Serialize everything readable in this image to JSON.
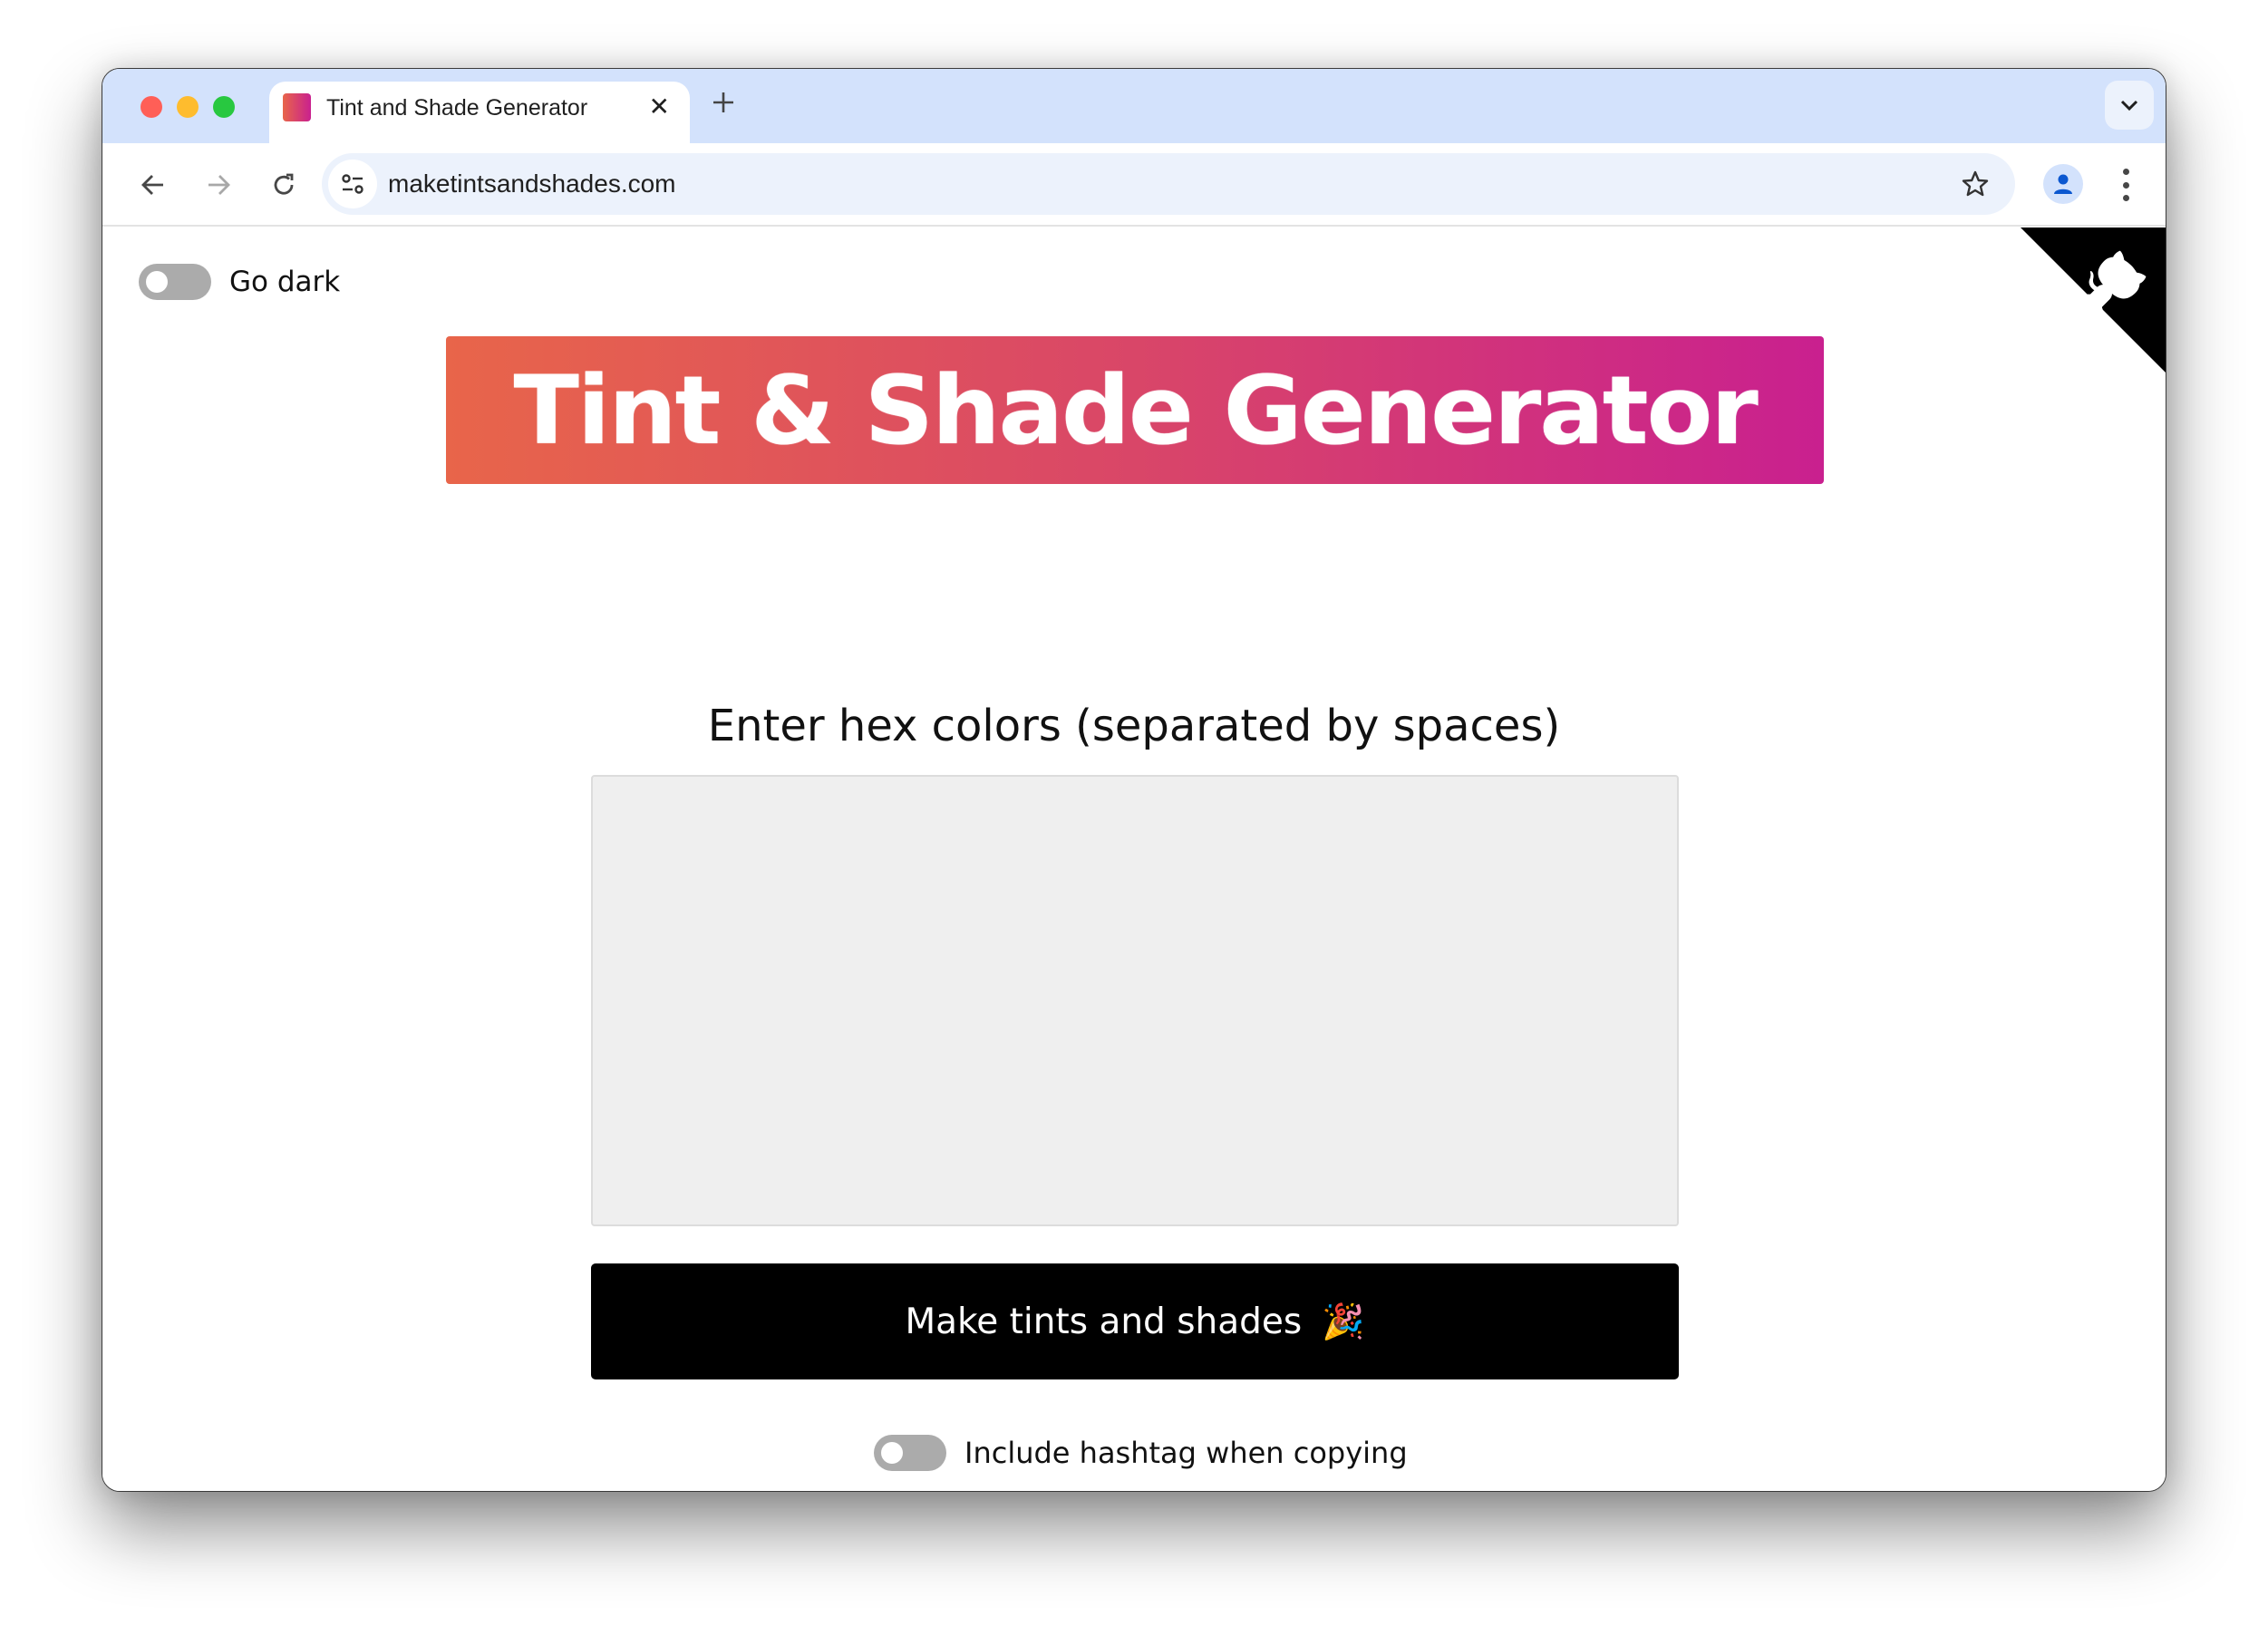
{
  "browser": {
    "tab": {
      "title": "Tint and Shade Generator",
      "close_icon": "close-icon",
      "favicon_colors": [
        "#e8654a",
        "#c9208f"
      ]
    },
    "new_tab_icon": "plus-icon",
    "tab_search_icon": "chevron-down-icon",
    "nav": {
      "back_icon": "arrow-left-icon",
      "forward_icon": "arrow-right-icon",
      "reload_icon": "reload-icon"
    },
    "address_bar": {
      "url": "maketintsandshades.com",
      "site_info_icon": "tune-icon",
      "bookmark_icon": "star-icon"
    },
    "profile_icon": "person-icon",
    "menu_icon": "kebab-menu-icon"
  },
  "page": {
    "dark_toggle": {
      "label": "Go dark",
      "on": false
    },
    "title": "Tint & Shade Generator",
    "title_gradient": [
      "#e8654a",
      "#c9208f"
    ],
    "github_corner_icon": "octocat-icon",
    "input": {
      "label": "Enter hex colors (separated by spaces)",
      "value": "",
      "placeholder": ""
    },
    "submit_button": {
      "label": "Make tints and shades",
      "emoji": "🎉"
    },
    "hashtag_toggle": {
      "label": "Include hashtag when copying",
      "on": false
    }
  }
}
